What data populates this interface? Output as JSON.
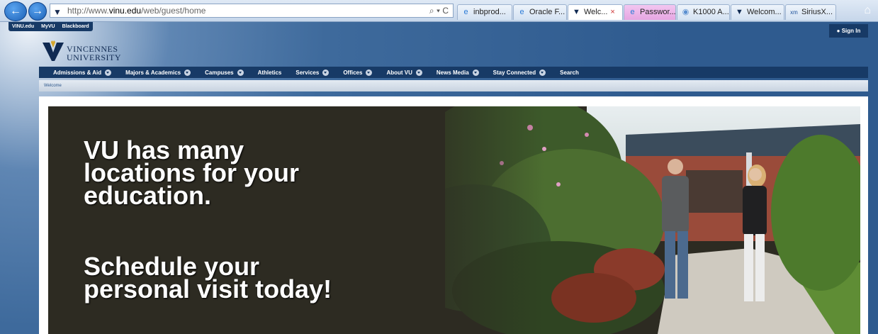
{
  "browser": {
    "url_prefix": "http://www.",
    "url_domain": "vinu.edu",
    "url_path": "/web/guest/home",
    "address_tools": "⌕ ▾ C",
    "tabs": [
      {
        "label": "inbprod...",
        "icon": "ie-icon"
      },
      {
        "label": "Oracle F...",
        "icon": "ie-icon"
      },
      {
        "label": "Welc...",
        "icon": "vu-icon",
        "active": true
      },
      {
        "label": "Passwor...",
        "icon": "ie-icon",
        "highlight": "#e6a6e2"
      },
      {
        "label": "K1000 A...",
        "icon": "kace-icon"
      },
      {
        "label": "Welcom...",
        "icon": "vu-icon"
      },
      {
        "label": "SiriusX...",
        "icon": "siriusxm-icon"
      }
    ],
    "tab_close": "×"
  },
  "site": {
    "topbar": [
      "VINU.edu",
      "MyVU",
      "Blackboard"
    ],
    "signin": "Sign In",
    "logo_line1": "VINCENNES",
    "logo_line2": "UNIVERSITY",
    "nav": [
      {
        "label": "Admissions & Aid",
        "dropdown": true
      },
      {
        "label": "Majors & Academics",
        "dropdown": true
      },
      {
        "label": "Campuses",
        "dropdown": true
      },
      {
        "label": "Athletics",
        "dropdown": false
      },
      {
        "label": "Services",
        "dropdown": true
      },
      {
        "label": "Offices",
        "dropdown": true
      },
      {
        "label": "About VU",
        "dropdown": true
      },
      {
        "label": "News Media",
        "dropdown": true
      },
      {
        "label": "Stay Connected",
        "dropdown": true
      },
      {
        "label": "Search",
        "dropdown": false
      }
    ],
    "breadcrumb": "Welcome"
  },
  "hero": {
    "line1": "VU has many",
    "line2": "locations for your",
    "line3": "education.",
    "line4": "Schedule your",
    "line5": "personal visit today!"
  },
  "colors": {
    "nav_bg": "#173a66",
    "brand_gold": "#d6a62a",
    "brand_navy": "#102a52"
  }
}
